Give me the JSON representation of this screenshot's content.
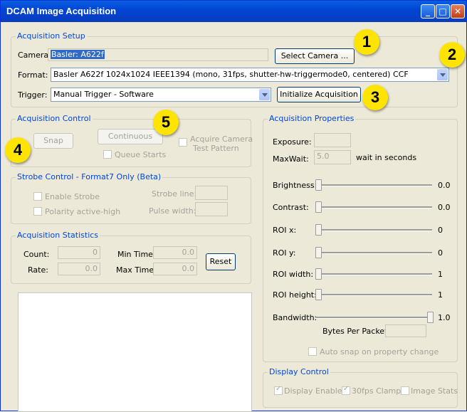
{
  "window": {
    "title": "DCAM Image Acquisition"
  },
  "setup": {
    "legend": "Acquisition Setup",
    "camera_label": "Camera:",
    "camera_value": "Basler: A622f",
    "select_camera_btn": "Select Camera ...",
    "format_label": "Format:",
    "format_value": "Basler A622f 1024x1024 IEEE1394 (mono, 31fps, shutter-hw-triggermode0, centered) CCF",
    "trigger_label": "Trigger:",
    "trigger_value": "Manual Trigger - Software",
    "init_btn": "Initialize Acquisition"
  },
  "control": {
    "legend": "Acquisition Control",
    "snap_btn": "Snap",
    "continuous_btn": "Continuous",
    "queue_starts": "Queue Starts",
    "test_pattern_1": "Acquire Camera",
    "test_pattern_2": "Test Pattern"
  },
  "strobe": {
    "legend": "Strobe Control - Format7 Only (Beta)",
    "enable": "Enable Strobe",
    "polarity": "Polarity active-high",
    "line_label": "Strobe line:",
    "width_label": "Pulse width:"
  },
  "stats": {
    "legend": "Acquisition Statistics",
    "count_label": "Count:",
    "count_value": "0",
    "rate_label": "Rate:",
    "rate_value": "0.0",
    "min_label": "Min Time:",
    "min_value": "0.0",
    "max_label": "Max Time:",
    "max_value": "0.0",
    "reset_btn": "Reset"
  },
  "props": {
    "legend": "Acquisition Properties",
    "exposure_label": "Exposure:",
    "maxwait_label": "MaxWait:",
    "maxwait_value": "5.0",
    "maxwait_unit": "wait in seconds",
    "sliders": [
      {
        "label": "Brightness:",
        "value": "0.0",
        "level": 0
      },
      {
        "label": "Contrast:",
        "value": "0.0",
        "level": 0
      },
      {
        "label": "ROI x:",
        "value": "0",
        "level": 0
      },
      {
        "label": "ROI y:",
        "value": "0",
        "level": 0
      },
      {
        "label": "ROI width:",
        "value": "1",
        "level": 0
      },
      {
        "label": "ROI height:",
        "value": "1",
        "level": 0
      },
      {
        "label": "Bandwidth:",
        "value": "1.0",
        "level": 1
      }
    ],
    "bytes_per_packet_label": "Bytes Per Packet",
    "auto_snap": "Auto snap on property change"
  },
  "display": {
    "legend": "Display Control",
    "enable": "Display Enable",
    "clamp": "30fps Clamp",
    "stats": "Image Stats"
  },
  "callouts": [
    "1",
    "2",
    "3",
    "4",
    "5"
  ],
  "colors": {
    "title_bar": "#0046d5",
    "group_legend": "#0046d5",
    "callout": "#ffe400",
    "selection": "#316ac5"
  }
}
